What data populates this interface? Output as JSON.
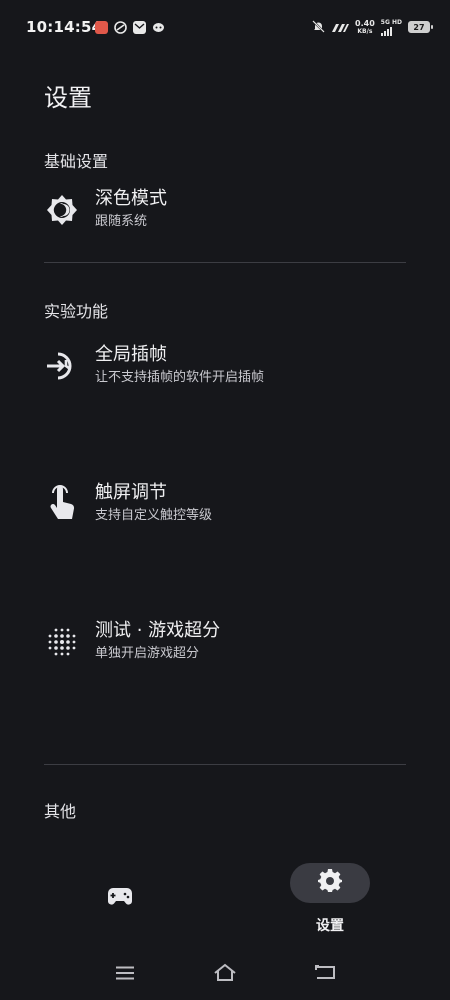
{
  "status_bar": {
    "time": "10:14:54",
    "net_speed_value": "0.40",
    "net_speed_unit": "KB/s",
    "network_tag_1": "5G",
    "network_tag_2": "HD",
    "battery": "27"
  },
  "page": {
    "title": "设置"
  },
  "sections": {
    "basic": {
      "header": "基础设置",
      "items": [
        {
          "title": "深色模式",
          "subtitle": "跟随系统",
          "icon": "dark-mode-icon"
        }
      ]
    },
    "experimental": {
      "header": "实验功能",
      "items": [
        {
          "title": "全局插帧",
          "subtitle": "让不支持插帧的软件开启插帧",
          "icon": "frame-interpolation-icon"
        },
        {
          "title": "触屏调节",
          "subtitle": "支持自定义触控等级",
          "icon": "touch-icon"
        },
        {
          "title": "测试 · 游戏超分",
          "subtitle": "单独开启游戏超分",
          "icon": "dot-grid-icon"
        }
      ]
    },
    "other": {
      "header": "其他"
    }
  },
  "bottom_nav": {
    "settings_label": "设置"
  },
  "colors": {
    "background": "#16171b",
    "pill": "#3a3b42",
    "divider": "#3c3d43",
    "text_primary": "#f0f0f2"
  }
}
